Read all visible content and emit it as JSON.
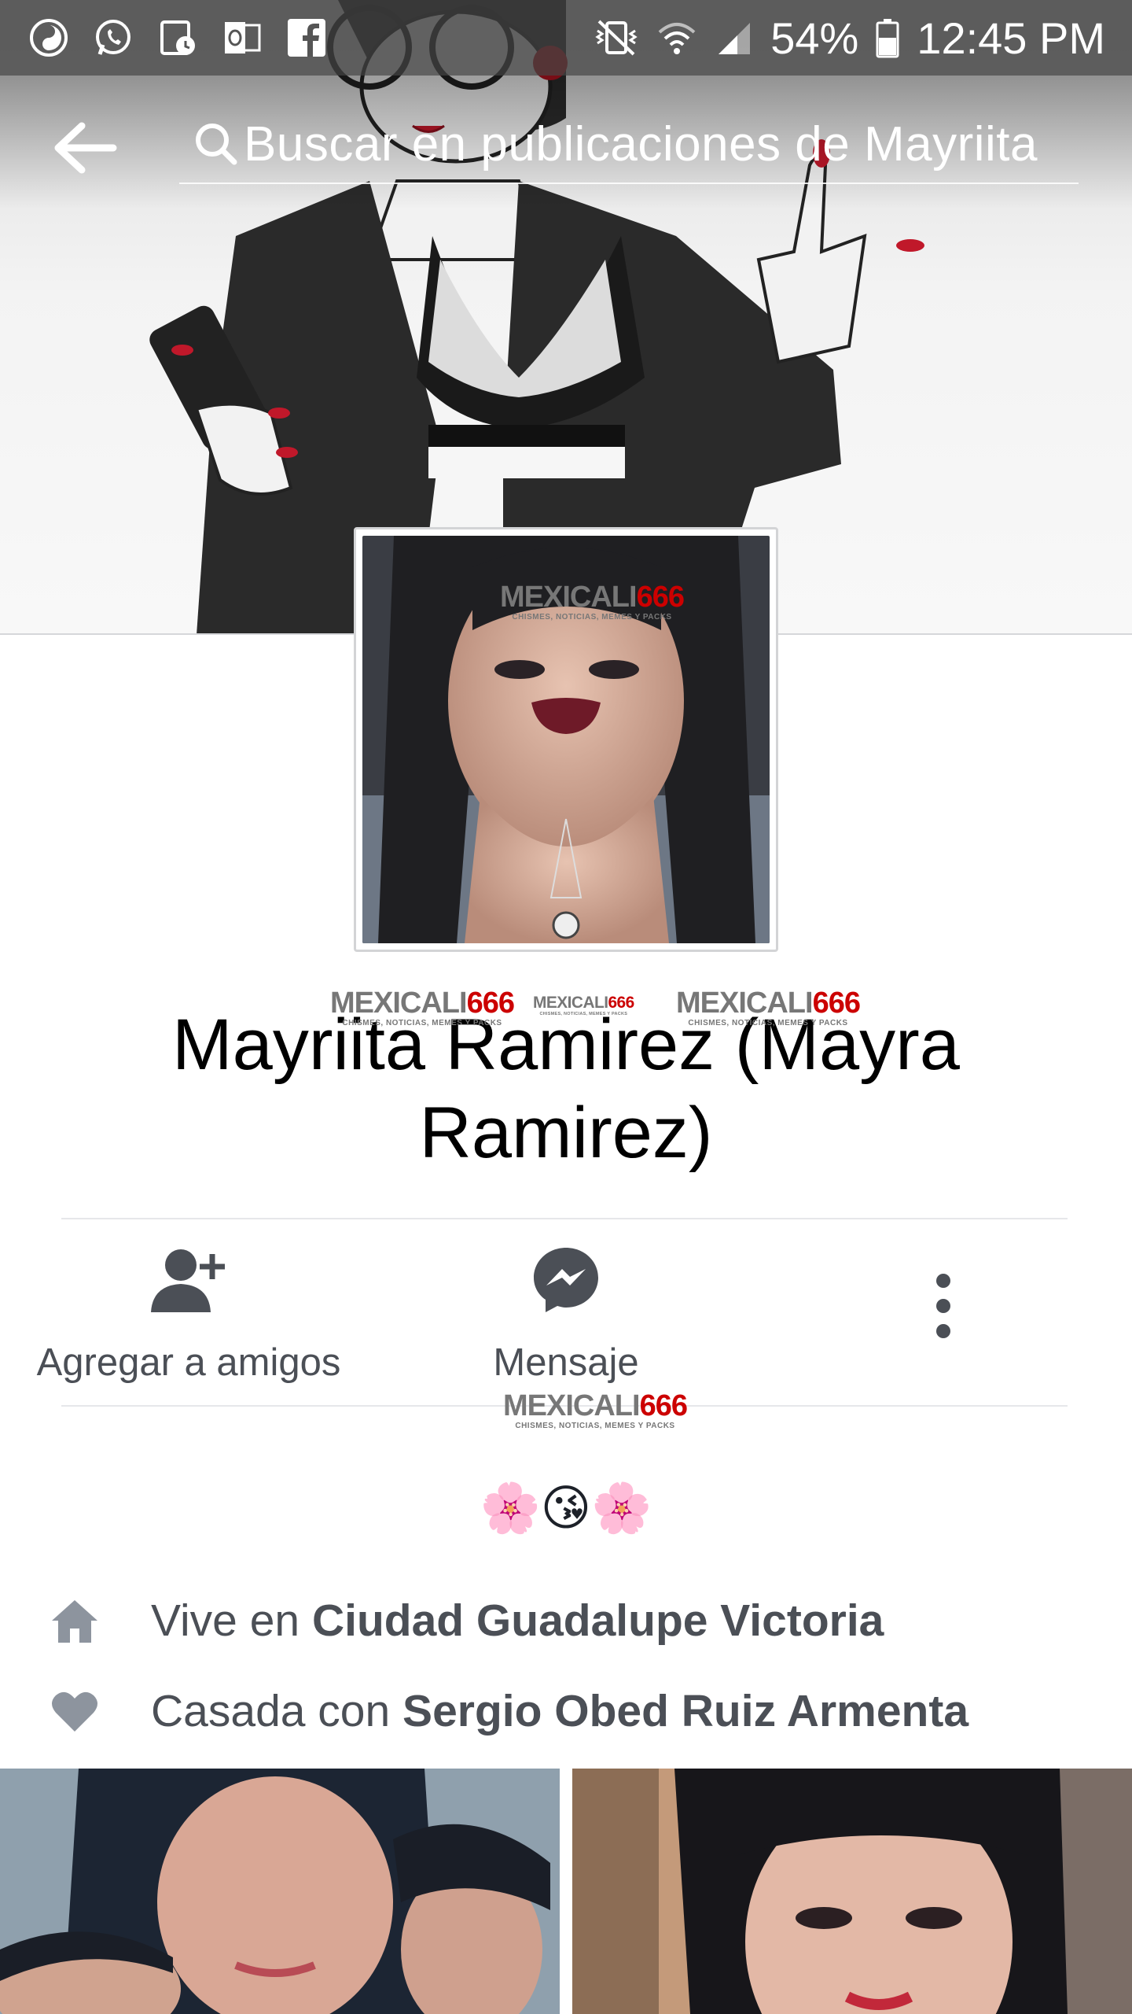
{
  "status_bar": {
    "battery": "54%",
    "time": "12:45 PM",
    "left_icons": [
      "swirl-app-icon",
      "whatsapp-icon",
      "calendar-icon",
      "outlook-icon",
      "facebook-icon"
    ],
    "right_icons": [
      "vibrate-icon",
      "wifi-icon",
      "signal-icon",
      "battery-icon"
    ]
  },
  "top_bar": {
    "search_text": "Buscar en publicaciones de Mayriita"
  },
  "watermark": {
    "brand_a": "MEXICALI",
    "brand_b": "666",
    "tagline": "CHISMES, NOTICIAS, MEMES Y PACKS"
  },
  "profile": {
    "name": "Mayriita Ramirez (Mayra Ramirez)",
    "bio": "🌸😘🌸"
  },
  "actions": {
    "add_friend": "Agregar a amigos",
    "message": "Mensaje"
  },
  "info": {
    "lives_prefix": "Vive en ",
    "lives_place": "Ciudad Guadalupe Victoria",
    "married_prefix": "Casada con ",
    "married_name": "Sergio Obed Ruiz Armenta"
  },
  "colors": {
    "icon_gray": "#4b4f56",
    "watermark_red": "#cc0000",
    "divider": "#e6e7ea"
  }
}
